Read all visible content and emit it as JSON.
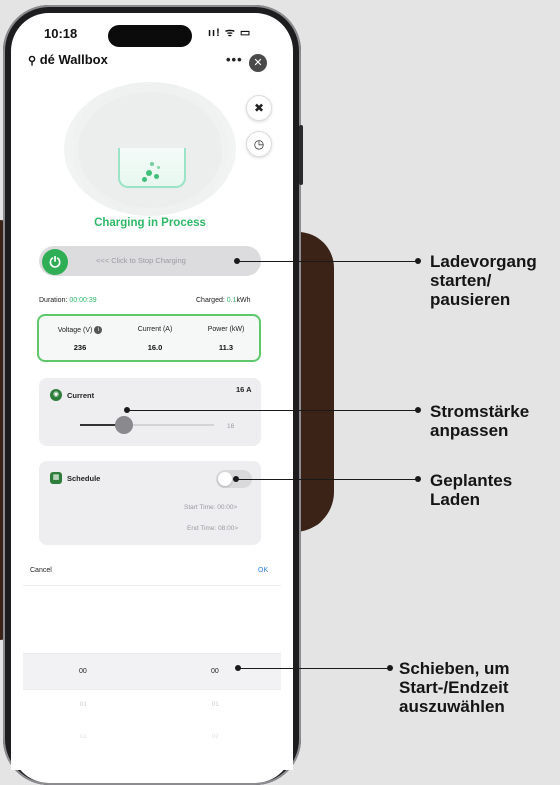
{
  "status_bar": {
    "time": "10:18",
    "icons": "ıı! ᯤ ▭"
  },
  "app": {
    "title": "dé Wallbox",
    "more_icon": "•••",
    "close_icon": "✕"
  },
  "header_buttons": {
    "tools_icon": "✖",
    "history_icon": "◷"
  },
  "charging": {
    "status": "Charging in Process",
    "slide_label": "<<< Click to Stop Charging",
    "power_icon": "⏻",
    "duration_label": "Duration:",
    "duration_value": "00:00:39",
    "charged_label": "Charged:",
    "charged_value": "0.1",
    "charged_unit": "kWh"
  },
  "readings": [
    {
      "label": "Voltage (V)",
      "value": "236"
    },
    {
      "label": "Current (A)",
      "value": "16.0"
    },
    {
      "label": "Power (kW)",
      "value": "11.3"
    }
  ],
  "current_card": {
    "title": "Current",
    "value_label": "16 A",
    "slider_max": "16",
    "slider_fraction": 0.33
  },
  "schedule_card": {
    "title": "Schedule",
    "start_time": "Start Time: 00:00>",
    "end_time": "End Time: 08:00>"
  },
  "picker": {
    "cancel": "Cancel",
    "ok": "OK",
    "selected_left": "00",
    "selected_right": "00",
    "next_left": "01",
    "next_right": "01",
    "after_left": "02",
    "after_right": "02"
  },
  "annotations": [
    {
      "text": "Ladevorgang\nstarten/\npausieren"
    },
    {
      "text": "Stromstärke\nanpassen"
    },
    {
      "text": "Geplantes\nLaden"
    },
    {
      "text": "Schieben, um\nStart-/Endzeit\nauszuwählen"
    }
  ]
}
